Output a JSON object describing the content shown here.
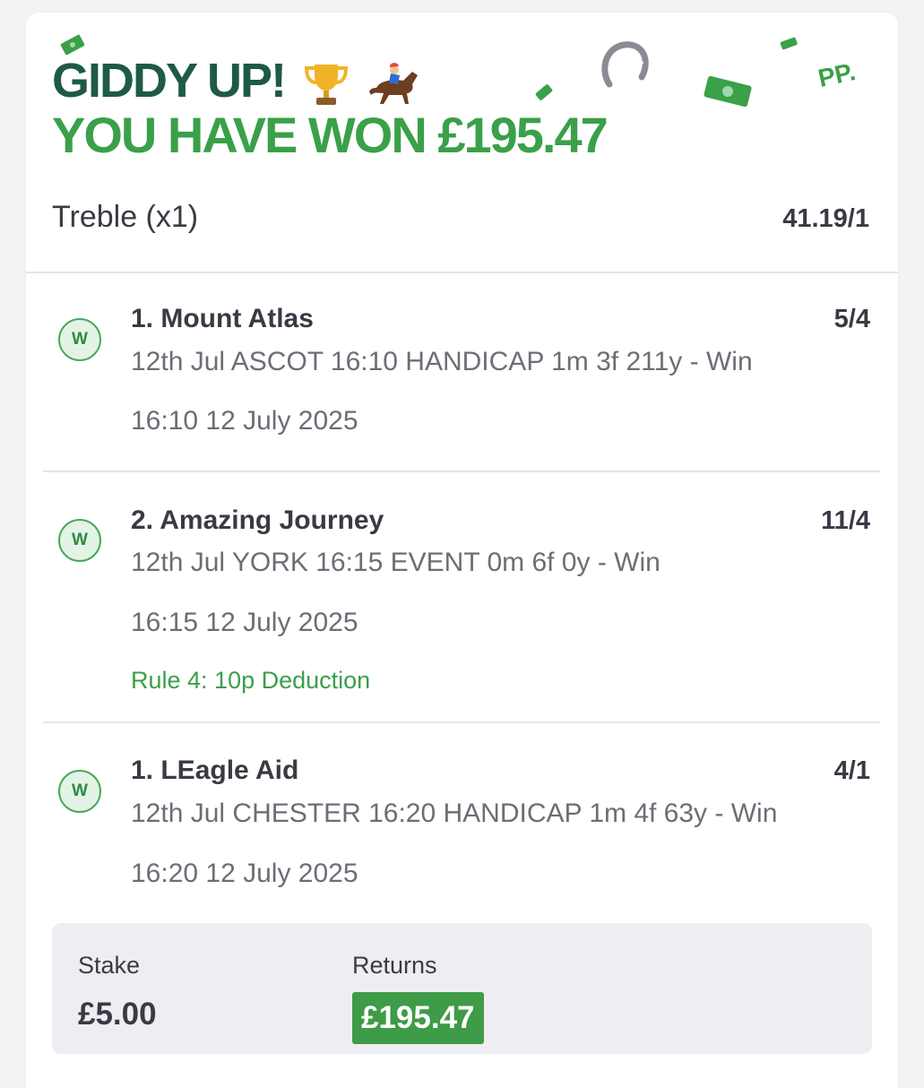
{
  "header": {
    "headline": "GIDDY UP!",
    "headline_icons": [
      "trophy-icon",
      "horse-racing-icon"
    ],
    "won_text": "YOU HAVE WON £195.47",
    "bet_type": "Treble (x1)",
    "total_odds": "41.19/1",
    "decoration_text": "PP."
  },
  "selections": [
    {
      "badge": "W",
      "name": "1. Mount Atlas",
      "odds": "5/4",
      "event": "12th Jul ASCOT 16:10 HANDICAP 1m 3f 211y - Win",
      "time": "16:10 12 July 2025"
    },
    {
      "badge": "W",
      "name": "2. Amazing Journey",
      "odds": "11/4",
      "event": "12th Jul YORK 16:15 EVENT 0m 6f 0y - Win",
      "time": "16:15 12 July 2025",
      "rule": "Rule 4: 10p Deduction"
    },
    {
      "badge": "W",
      "name": "1. LEagle Aid",
      "odds": "4/1",
      "event": "12th Jul CHESTER 16:20 HANDICAP 1m 4f 63y - Win",
      "time": "16:20 12 July 2025"
    }
  ],
  "summary": {
    "stake_label": "Stake",
    "stake_value": "£5.00",
    "returns_label": "Returns",
    "returns_value": "£195.47"
  },
  "colors": {
    "headline_dark_green": "#1e5a45",
    "brand_green": "#3aa049",
    "returns_badge_green": "#3e9b47",
    "text_dark": "#3a3a44",
    "text_muted": "#6d6d76"
  }
}
